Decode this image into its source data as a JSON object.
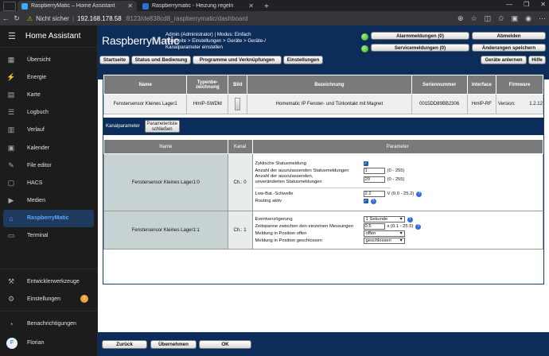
{
  "browser": {
    "tabs": [
      {
        "title": "RaspberryMatic – Home Assistant",
        "favicon_color": "#3fa9f5",
        "active": true
      },
      {
        "title": "Raspberrymatic - Heizung regeln",
        "favicon_color": "#2a6fd6",
        "active": false
      }
    ],
    "new_tab": "+",
    "security_label": "Nicht sicher",
    "url_host": "192.168.178.58",
    "url_rest": ":8123/de838cd8_raspberrymatic/dashboard"
  },
  "sidebar": {
    "title": "Home Assistant",
    "items": [
      {
        "label": "Übersicht",
        "icon": "grid-icon",
        "glyph": "▦"
      },
      {
        "label": "Energie",
        "icon": "lightning-icon",
        "glyph": "⚡"
      },
      {
        "label": "Karte",
        "icon": "map-icon",
        "glyph": "▤"
      },
      {
        "label": "Logbuch",
        "icon": "list-icon",
        "glyph": "☰"
      },
      {
        "label": "Verlauf",
        "icon": "chart-icon",
        "glyph": "▥"
      },
      {
        "label": "Kalender",
        "icon": "calendar-icon",
        "glyph": "▣"
      },
      {
        "label": "File editor",
        "icon": "wrench-icon",
        "glyph": "✎"
      },
      {
        "label": "HACS",
        "icon": "hacs-icon",
        "glyph": "▢"
      },
      {
        "label": "Medien",
        "icon": "media-icon",
        "glyph": "▶"
      },
      {
        "label": "RaspberryMatic",
        "icon": "home-icon",
        "glyph": "⌂",
        "active": true
      },
      {
        "label": "Terminal",
        "icon": "terminal-icon",
        "glyph": "▭"
      }
    ],
    "dev_tools": {
      "label": "Entwicklerwerkzeuge",
      "icon": "hammer-icon",
      "glyph": "⚒"
    },
    "settings": {
      "label": "Einstellungen",
      "icon": "gear-icon",
      "glyph": "⚙",
      "badge": "1"
    },
    "notifications": {
      "label": "Benachrichtigungen",
      "icon": "bell-icon",
      "glyph": "🔔"
    },
    "user": {
      "label": "Florian",
      "initial": "F"
    }
  },
  "header": {
    "logo_a": "Raspberry",
    "logo_b": "Matic",
    "user_line": "Admin (Administrator) | Modus: Einfach",
    "breadcrumb_line1": "Startseite > Einstellungen > Geräte > Geräte-/",
    "breadcrumb_line2": "Kanalparameter einstellen",
    "alarm_button": "Alarmmeldungen (0)",
    "service_button": "Servicemeldungen (0)",
    "logout_button": "Abmelden",
    "save_changes_button": "Änderungen speichern"
  },
  "menubar": {
    "start": "Startseite",
    "status": "Status und Bedienung",
    "programs": "Programme und Verknüpfungen",
    "settings": "Einstellungen",
    "teach": "Geräte anlernen",
    "help": "Hilfe"
  },
  "device_table": {
    "headers": [
      "Name",
      "Typenbe-zeichnung",
      "Bild",
      "Bezeichnung",
      "Seriennummer",
      "Interface",
      "Firmware"
    ],
    "row": {
      "name": "Fenstersensor Kleines Lager1",
      "type": "HmIP-SWDM",
      "description": "Homematic IP Fenster- und Türkontakt mit Magnet",
      "serial": "0015DD89BB2306",
      "interface": "HmIP-RF",
      "firmware_label": "Version:",
      "firmware": "1.2.12"
    }
  },
  "channel_params": {
    "label": "Kanalparameter",
    "close_button_line1": "Parameterliste",
    "close_button_line2": "schließen",
    "headers": [
      "Name",
      "Kanal",
      "Parameter"
    ],
    "ch0": {
      "name": "Fenstersensor Kleines Lager1:0",
      "channel": "Ch.: 0",
      "cyclic_label": "Zyklische Statusmeldung",
      "count_label": "Anzahl der auszulassenden Statusmeldungen",
      "count_value": "1",
      "count_range": "(0 - 255)",
      "unchanged_label1": "Anzahl der auszulassenden,",
      "unchanged_label2": "unveränderten Statusmeldungen",
      "unchanged_value": "20",
      "unchanged_range": "(0 - 255)",
      "lowbat_label": "Low-Bat.-Schwelle",
      "lowbat_value": "2.2",
      "lowbat_range": "V (0.0 - 25.2)",
      "routing_label": "Routing aktiv"
    },
    "ch1": {
      "name": "Fenstersensor Kleines Lager1:1",
      "channel": "Ch.: 1",
      "delay_label": "Eventverzögerung",
      "delay_value": "1 Sekunde",
      "span_label": "Zeitspanne zwischen den einzelnen Messungen",
      "span_value": "0.5",
      "span_range": "s (0.1 - 25.5)",
      "open_label": "Meldung in Position offen",
      "open_value": "offen",
      "closed_label": "Meldung in Position geschlossen",
      "closed_value": "geschlossen"
    }
  },
  "footer": {
    "back": "Zurück",
    "apply": "Übernehmen",
    "ok": "OK"
  }
}
